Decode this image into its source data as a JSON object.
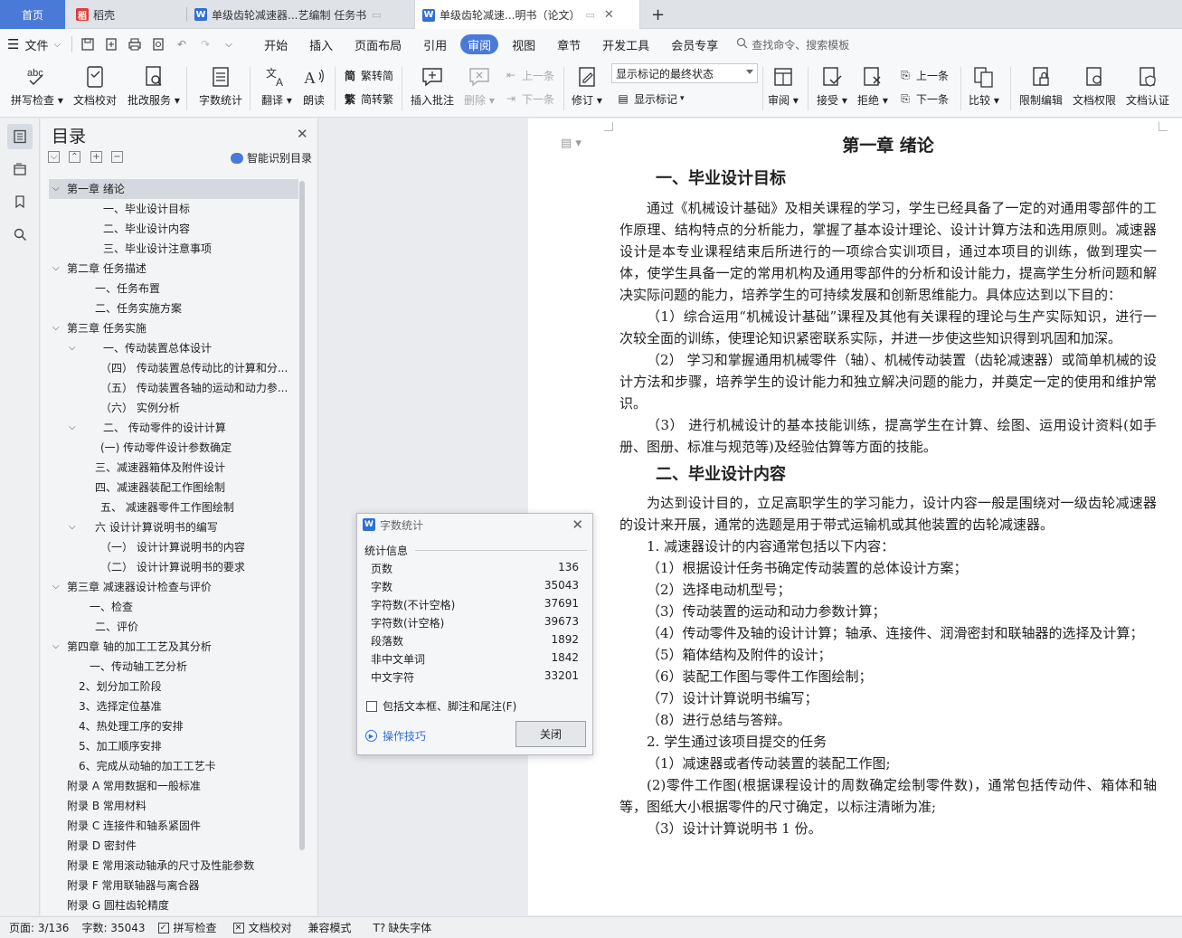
{
  "tabs": {
    "home": "首页",
    "daoke": "稻壳",
    "doc1": "单级齿轮减速器...艺编制 任务书",
    "doc2": "单级齿轮减速...明书（论文）",
    "add": "+"
  },
  "menu": {
    "file": "文件",
    "tabs": [
      "开始",
      "插入",
      "页面布局",
      "引用",
      "审阅",
      "视图",
      "章节",
      "开发工具",
      "会员专享"
    ],
    "search": "查找命令、搜索模板"
  },
  "ribbon": {
    "spellcheck": "拼写检查",
    "doccheck": "文档校对",
    "annotate": "批改服务",
    "wordcount": "字数统计",
    "translate": "翻译",
    "read": "朗读",
    "to_trad": "繁转简",
    "to_simp": "简转繁",
    "insert_comment": "插入批注",
    "delete": "删除",
    "prev_comment": "上一条",
    "next_comment": "下一条",
    "track": "修订",
    "markup_state": "显示标记的最终状态",
    "show_markup": "显示标记",
    "review": "审阅",
    "accept": "接受",
    "reject": "拒绝",
    "prev": "上一条",
    "next": "下一条",
    "compare": "比较",
    "restrict": "限制编辑",
    "permission": "文档权限",
    "certify": "文档认证"
  },
  "toc": {
    "title": "目录",
    "smart": "智能识别目录",
    "items": [
      {
        "text": "第一章  绪论",
        "level": 0,
        "arrow": true
      },
      {
        "text": "一、毕业设计目标",
        "level": 2
      },
      {
        "text": "二、毕业设计内容",
        "level": 2
      },
      {
        "text": "三、毕业设计注意事项",
        "level": 2
      },
      {
        "text": "第二章    任务描述",
        "level": 0,
        "arrow": true
      },
      {
        "text": "一、任务布置",
        "level": 1.7
      },
      {
        "text": "二、任务实施方案",
        "level": 1.7
      },
      {
        "text": "第三章    任务实施",
        "level": 0,
        "arrow": true
      },
      {
        "text": "一、传动装置总体设计",
        "level": 2,
        "arrow": true
      },
      {
        "text": "（四）   传动装置总传动比的计算和分...",
        "level": 1.9
      },
      {
        "text": "（五）   传动装置各轴的运动和动力参...",
        "level": 1.9
      },
      {
        "text": "（六）   实例分析",
        "level": 1.9
      },
      {
        "text": "二、    传动零件的设计计算",
        "level": 2,
        "arrow": true
      },
      {
        "text": "(一)    传动零件设计参数确定",
        "level": 1.9
      },
      {
        "text": "三、减速器箱体及附件设计",
        "level": 1.7
      },
      {
        "text": "四、减速器装配工作图绘制",
        "level": 1.7
      },
      {
        "text": "五、    减速器零件工作图绘制",
        "level": 1.9
      },
      {
        "text": "六    设计计算说明书的编写",
        "level": 1.7,
        "arrow": true
      },
      {
        "text": "（一）   设计计算说明书的内容",
        "level": 1.9
      },
      {
        "text": "（二）   设计计算说明书的要求",
        "level": 1.9
      },
      {
        "text": "第三章    减速器设计检查与评价",
        "level": 0,
        "arrow": true
      },
      {
        "text": "一、检查",
        "level": 1.5
      },
      {
        "text": "二、评价",
        "level": 1.7
      },
      {
        "text": "第四章    轴的加工工艺及其分析",
        "level": 0,
        "arrow": true
      },
      {
        "text": "一、传动轴工艺分析",
        "level": 1.5
      },
      {
        "text": "2、划分加工阶段",
        "level": 1.1
      },
      {
        "text": "3、选择定位基准",
        "level": 1.1
      },
      {
        "text": "4、热处理工序的安排",
        "level": 1.1
      },
      {
        "text": "5、加工顺序安排",
        "level": 1.1
      },
      {
        "text": "6、完成从动轴的加工工艺卡",
        "level": 1.1
      },
      {
        "text": "附录 A    常用数据和一般标准",
        "level": 0
      },
      {
        "text": "附录 B    常用材料",
        "level": 0
      },
      {
        "text": "附录 C    连接件和轴系紧固件",
        "level": 0
      },
      {
        "text": "附录 D    密封件",
        "level": 0
      },
      {
        "text": "附录 E    常用滚动轴承的尺寸及性能参数",
        "level": 0
      },
      {
        "text": "附录 F    常用联轴器与离合器",
        "level": 0
      },
      {
        "text": "附录 G    圆柱齿轮精度",
        "level": 0
      }
    ]
  },
  "doc": {
    "chapter": "第一章  绪论",
    "h_goal": "一、毕业设计目标",
    "p1": "通过《机械设计基础》及相关课程的学习，学生已经具备了一定的对通用零部件的工作原理、结构特点的分析能力，掌握了基本设计理论、设计计算方法和选用原则。减速器设计是本专业课程结束后所进行的一项综合实训项目，通过本项目的训练，做到理实一体，使学生具备一定的常用机构及通用零部件的分析和设计能力，提高学生分析问题和解决实际问题的能力，培养学生的可持续发展和创新思维能力。具体应达到以下目的：",
    "p2": "（1）综合运用“机械设计基础”课程及其他有关课程的理论与生产实际知识，进行一次较全面的训练，使理论知识紧密联系实际，并进一步使这些知识得到巩固和加深。",
    "p3": "（2）  学习和掌握通用机械零件（轴）、机械传动装置（齿轮减速器）或简单机械的设计方法和步骤，培养学生的设计能力和独立解决问题的能力，并奠定一定的使用和维护常识。",
    "p4": "（3）  进行机械设计的基本技能训练，提高学生在计算、绘图、运用设计资料(如手册、图册、标准与规范等)及经验估算等方面的技能。",
    "h_content": "二、毕业设计内容",
    "p5": "为达到设计目的，立足高职学生的学习能力，设计内容一般是围绕对一级齿轮减速器的设计来开展，通常的选题是用于带式运输机或其他装置的齿轮减速器。",
    "l1": "1. 减速器设计的内容通常包括以下内容：",
    "l2": "（1）根据设计任务书确定传动装置的总体设计方案；",
    "l3": "（2）选择电动机型号；",
    "l4": "（3）传动装置的运动和动力参数计算；",
    "l5": "（4）传动零件及轴的设计计算；轴承、连接件、润滑密封和联轴器的选择及计算；",
    "l6": "（5）箱体结构及附件的设计；",
    "l7": "（6）装配工作图与零件工作图绘制；",
    "l8": "（7）设计计算说明书编写；",
    "l9": "（8）进行总结与答辩。",
    "l10": "2. 学生通过该项目提交的任务",
    "l11": "（1）减速器或者传动装置的装配工作图;",
    "l12": "(2)零件工作图(根据课程设计的周数确定绘制零件数)，通常包括传动件、箱体和轴等，图纸大小根据零件的尺寸确定，以标注清晰为准;",
    "l13": "（3）设计计算说明书 1 份。"
  },
  "dialog": {
    "title": "字数统计",
    "section": "统计信息",
    "rows": [
      {
        "label": "页数",
        "value": "136"
      },
      {
        "label": "字数",
        "value": "35043"
      },
      {
        "label": "字符数(不计空格)",
        "value": "37691"
      },
      {
        "label": "字符数(计空格)",
        "value": "39673"
      },
      {
        "label": "段落数",
        "value": "1892"
      },
      {
        "label": "非中文单词",
        "value": "1842"
      },
      {
        "label": "中文字符",
        "value": "33201"
      }
    ],
    "include": "包括文本框、脚注和尾注(F)",
    "tips": "操作技巧",
    "close": "关闭"
  },
  "status": {
    "page": "页面: 3/136",
    "words": "字数: 35043",
    "spell": "拼写检查",
    "proof": "文档校对",
    "compat": "兼容模式",
    "missing_font": "缺失字体"
  }
}
